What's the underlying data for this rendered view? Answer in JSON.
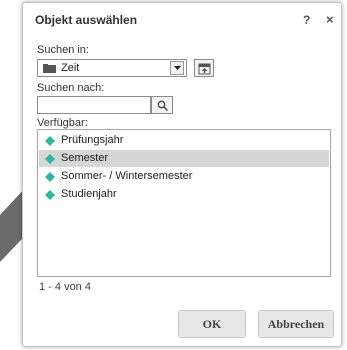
{
  "dialog": {
    "title": "Objekt auswählen",
    "help_label": "?",
    "close_label": "×"
  },
  "search_in": {
    "label": "Suchen in:",
    "value": "Zeit"
  },
  "search_for": {
    "label": "Suchen nach:",
    "value": "",
    "placeholder": ""
  },
  "available": {
    "label": "Verfügbar:",
    "items": [
      {
        "label": "Prüfungsjahr",
        "selected": false
      },
      {
        "label": "Semester",
        "selected": true
      },
      {
        "label": "Sommer- / Wintersemester",
        "selected": false
      },
      {
        "label": "Studienjahr",
        "selected": false
      }
    ],
    "count_text": "1 - 4 von 4"
  },
  "buttons": {
    "ok_label": "OK",
    "cancel_label": "Abbrechen"
  },
  "icons": {
    "folder": "folder-icon",
    "dropdown": "chevron-down-icon",
    "up_folder": "folder-up-icon",
    "search": "search-icon",
    "item_marker": "diamond-icon"
  },
  "colors": {
    "item_marker": "#2fb5a0",
    "selection_bg": "#d6d6d6",
    "backdrop_arrow": "#6b6b6b"
  }
}
